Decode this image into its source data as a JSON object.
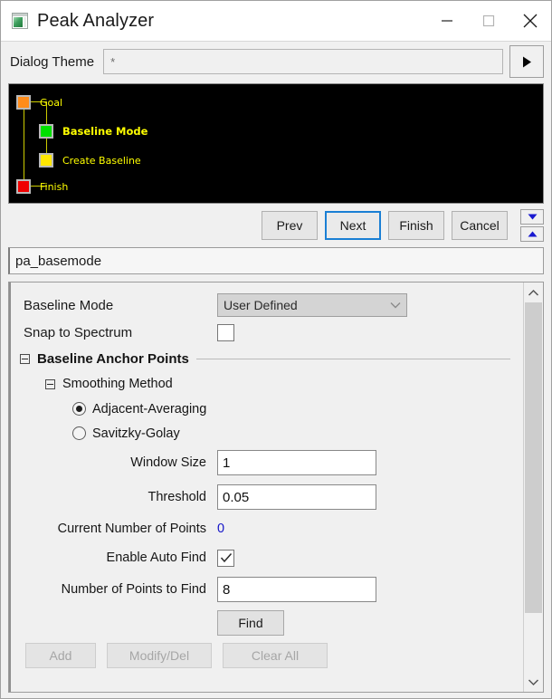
{
  "window": {
    "title": "Peak Analyzer",
    "app_icon": "chart-window-icon",
    "controls": {
      "minimize": "minimize-icon",
      "maximize": "maximize-icon",
      "close": "close-icon"
    }
  },
  "theme": {
    "label": "Dialog Theme",
    "value": "*",
    "arrow_button": "play-triangle-icon"
  },
  "tree": {
    "nodes": [
      {
        "label": "Goal",
        "color": "#ff8c1a",
        "bold": false
      },
      {
        "label": "Baseline Mode",
        "color": "#00e000",
        "bold": true
      },
      {
        "label": "Create Baseline",
        "color": "#ffe600",
        "bold": false
      },
      {
        "label": "Finish",
        "color": "#f00000",
        "bold": false
      }
    ],
    "background": "#000000",
    "label_color": "#ffff00",
    "connector_color": "#cccc00"
  },
  "nav": {
    "prev": "Prev",
    "next": "Next",
    "finish": "Finish",
    "cancel": "Cancel",
    "focused": "Next",
    "spin_down": "triangle-down-icon",
    "spin_up": "triangle-up-icon",
    "spin_color": "#1a1ad0"
  },
  "name_field": {
    "value": "pa_basemode"
  },
  "form": {
    "baseline_mode": {
      "label": "Baseline Mode",
      "value": "User Defined",
      "chevron": "chevron-down-icon"
    },
    "snap_to_spectrum": {
      "label": "Snap to Spectrum",
      "checked": false
    },
    "anchor_points_group": {
      "title": "Baseline Anchor Points",
      "expanded": true
    },
    "smoothing_group": {
      "title": "Smoothing Method",
      "expanded": true,
      "options": [
        {
          "label": "Adjacent-Averaging",
          "selected": true
        },
        {
          "label": "Savitzky-Golay",
          "selected": false
        }
      ]
    },
    "window_size": {
      "label": "Window Size",
      "value": "1"
    },
    "threshold": {
      "label": "Threshold",
      "value": "0.05"
    },
    "current_points": {
      "label": "Current Number of Points",
      "value": "0",
      "color": "#1414c8"
    },
    "enable_auto_find": {
      "label": "Enable Auto Find",
      "checked": true,
      "check_icon": "checkmark-icon"
    },
    "points_to_find": {
      "label": "Number of Points to Find",
      "value": "8"
    },
    "find_button": "Find",
    "action_buttons": {
      "add": "Add",
      "modify_del": "Modify/Del",
      "clear_all": "Clear All",
      "disabled": true
    }
  },
  "scrollbar": {
    "up": "chevron-up-icon",
    "down": "chevron-down-icon"
  }
}
